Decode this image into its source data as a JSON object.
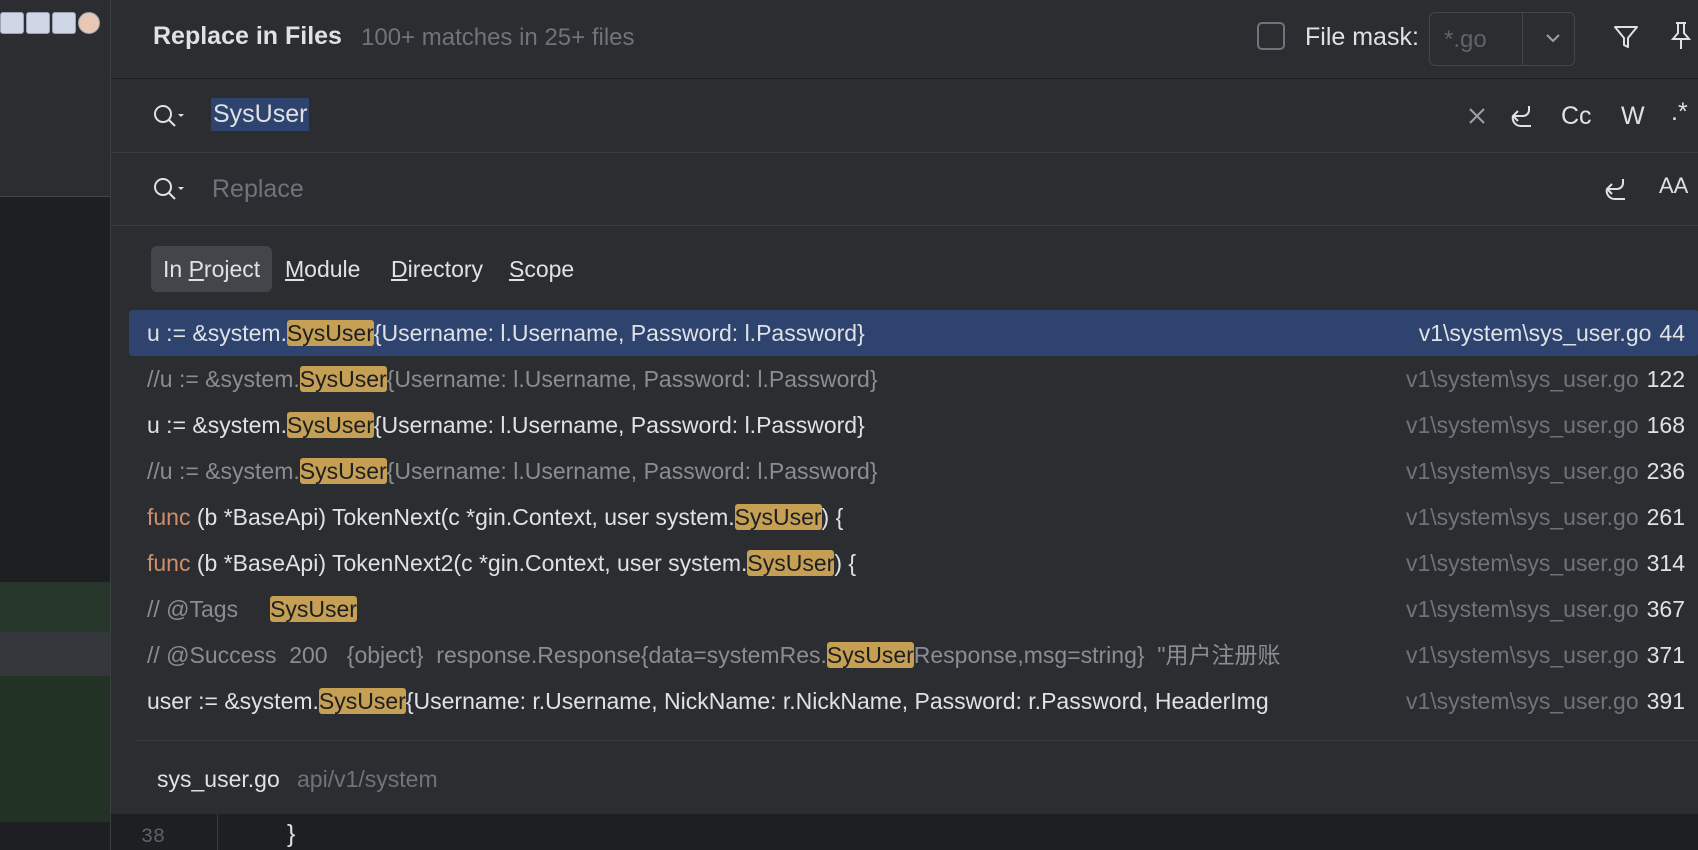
{
  "dialog": {
    "title": "Replace in Files",
    "match_summary": "100+ matches in 25+ files",
    "file_mask_label": "File mask:",
    "file_mask_value": "*.go",
    "file_mask_checked": false
  },
  "search": {
    "query": "SysUser",
    "buttons": {
      "match_case": "Cc",
      "words": "W",
      "regex": ".*"
    }
  },
  "replace": {
    "placeholder": "Replace",
    "preserve_case": "AA"
  },
  "scopes": [
    {
      "pre": "In ",
      "mnemonic": "P",
      "post": "roject"
    },
    {
      "pre": "",
      "mnemonic": "M",
      "post": "odule"
    },
    {
      "pre": "",
      "mnemonic": "D",
      "post": "irectory"
    },
    {
      "pre": "",
      "mnemonic": "S",
      "post": "cope"
    }
  ],
  "results": [
    {
      "kw": "",
      "before": "u := &system.",
      "match": "SysUser",
      "after": "{Username: l.Username, Password: l.Password}",
      "file": "v1\\system\\sys_user.go",
      "line": "44",
      "selected": true,
      "comment": false
    },
    {
      "kw": "",
      "before": "//u := &system.",
      "match": "SysUser",
      "after": "{Username: l.Username, Password: l.Password}",
      "file": "v1\\system\\sys_user.go",
      "line": "122",
      "selected": false,
      "comment": true
    },
    {
      "kw": "",
      "before": "u := &system.",
      "match": "SysUser",
      "after": "{Username: l.Username, Password: l.Password}",
      "file": "v1\\system\\sys_user.go",
      "line": "168",
      "selected": false,
      "comment": false
    },
    {
      "kw": "",
      "before": "//u := &system.",
      "match": "SysUser",
      "after": "{Username: l.Username, Password: l.Password}",
      "file": "v1\\system\\sys_user.go",
      "line": "236",
      "selected": false,
      "comment": true
    },
    {
      "kw": "func",
      "before": " (b *BaseApi) TokenNext(c *gin.Context, user system.",
      "match": "SysUser",
      "after": ") {",
      "file": "v1\\system\\sys_user.go",
      "line": "261",
      "selected": false,
      "comment": false
    },
    {
      "kw": "func",
      "before": " (b *BaseApi) TokenNext2(c *gin.Context, user system.",
      "match": "SysUser",
      "after": ") {",
      "file": "v1\\system\\sys_user.go",
      "line": "314",
      "selected": false,
      "comment": false
    },
    {
      "kw": "",
      "before": "// @Tags     ",
      "match": "SysUser",
      "after": "",
      "file": "v1\\system\\sys_user.go",
      "line": "367",
      "selected": false,
      "comment": true
    },
    {
      "kw": "",
      "before": "// @Success  200   {object}  response.Response{data=systemRes.",
      "match": "SysUser",
      "after": "Response,msg=string}  \"用户注册账",
      "file": "v1\\system\\sys_user.go",
      "line": "371",
      "selected": false,
      "comment": true
    },
    {
      "kw": "",
      "before": "user := &system.",
      "match": "SysUser",
      "after": "{Username: r.Username, NickName: r.NickName, Password: r.Password, HeaderImg",
      "file": "v1\\system\\sys_user.go",
      "line": "391",
      "selected": false,
      "comment": false
    }
  ],
  "preview": {
    "file_name": "sys_user.go",
    "file_path": "api/v1/system",
    "line_number": "38",
    "code": "}"
  }
}
